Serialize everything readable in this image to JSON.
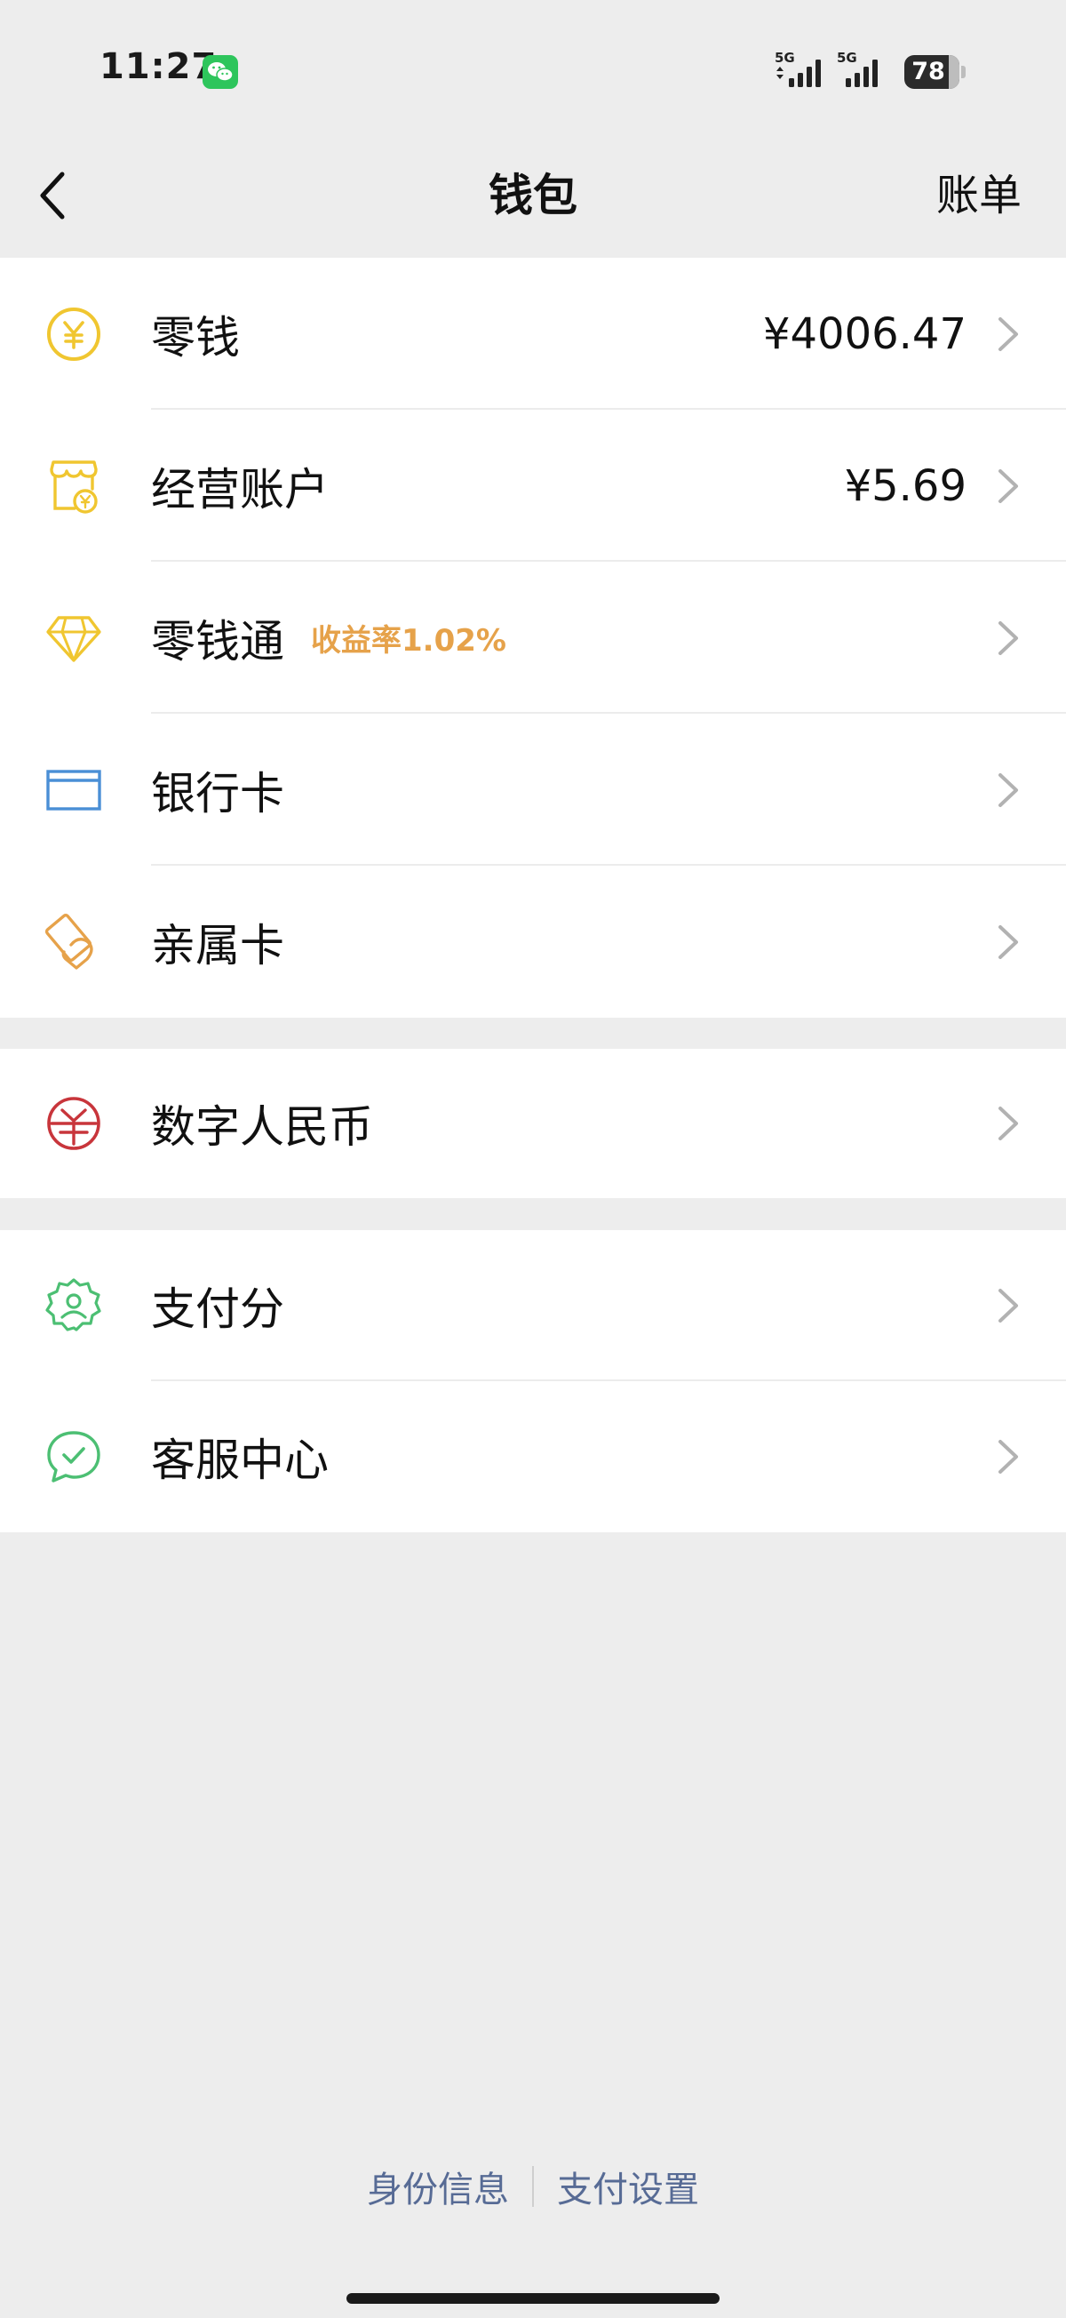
{
  "status_bar": {
    "time": "11:27",
    "network_1": "5G",
    "network_2": "5G",
    "battery": "78"
  },
  "nav": {
    "title": "钱包",
    "right_action": "账单"
  },
  "groups": [
    {
      "items": [
        {
          "label": "零钱",
          "value": "¥4006.47",
          "icon": "yuan-circle-icon"
        },
        {
          "label": "经营账户",
          "value": "¥5.69",
          "icon": "shop-account-icon"
        },
        {
          "label": "零钱通",
          "tag": "收益率1.02%",
          "icon": "diamond-icon"
        },
        {
          "label": "银行卡",
          "icon": "bank-card-icon"
        },
        {
          "label": "亲属卡",
          "icon": "family-card-icon"
        }
      ]
    },
    {
      "items": [
        {
          "label": "数字人民币",
          "icon": "digital-rmb-icon"
        }
      ]
    },
    {
      "items": [
        {
          "label": "支付分",
          "icon": "pay-score-icon"
        },
        {
          "label": "客服中心",
          "icon": "customer-service-icon"
        }
      ]
    }
  ],
  "footer": {
    "link_1": "身份信息",
    "link_2": "支付设置"
  },
  "colors": {
    "background": "#ededed",
    "link": "#576b95",
    "accent_tag": "#e6a24a",
    "yellow_icon": "#f0c630",
    "blue_icon": "#4a8fd6",
    "orange_icon": "#e6a24a",
    "red_icon": "#c8353b",
    "green_icon": "#4cbf73"
  }
}
